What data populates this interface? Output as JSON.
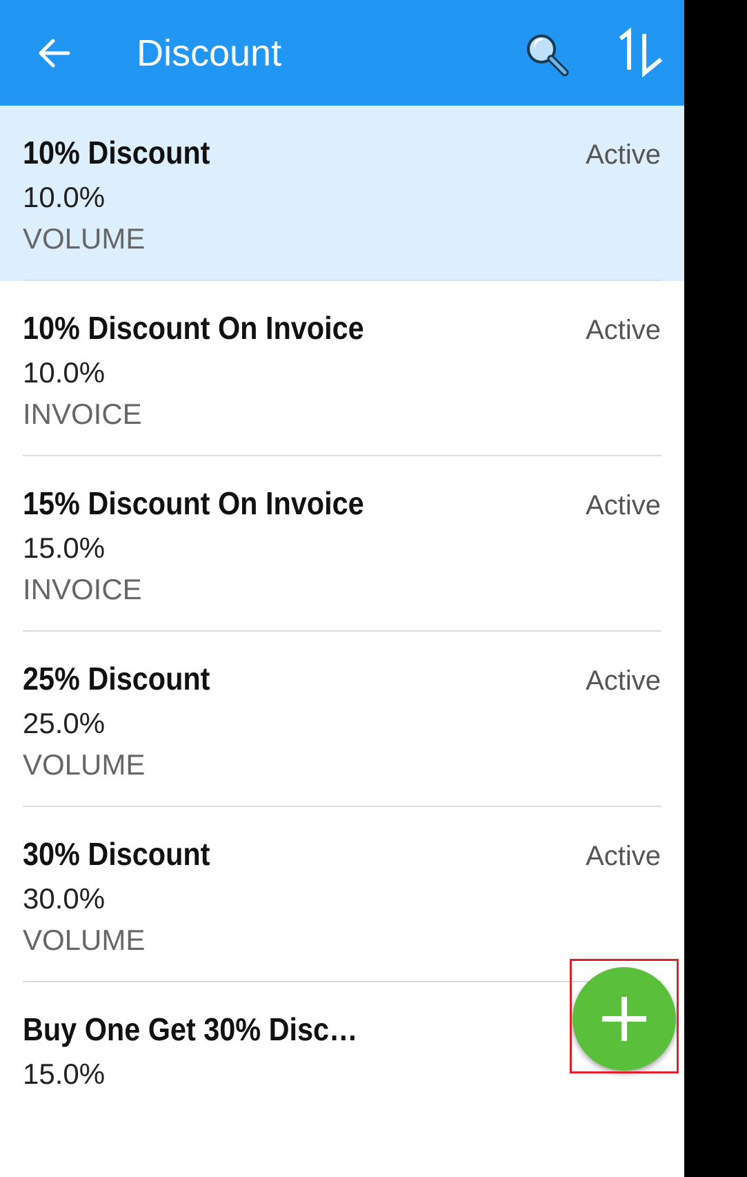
{
  "app_bar": {
    "title": "Discount",
    "color": "#2196f3",
    "back_icon": "arrow-left-icon",
    "search_icon": "search-icon",
    "sort_icon": "sort-icon"
  },
  "discounts": [
    {
      "name": "10% Discount",
      "amount": "10.0%",
      "type": "VOLUME",
      "status": "Active",
      "selected": true
    },
    {
      "name": "10% Discount On Invoice",
      "amount": "10.0%",
      "type": "INVOICE",
      "status": "Active"
    },
    {
      "name": "15% Discount On Invoice",
      "amount": "15.0%",
      "type": "INVOICE",
      "status": "Active"
    },
    {
      "name": "25% Discount",
      "amount": "25.0%",
      "type": "VOLUME",
      "status": "Active"
    },
    {
      "name": "30% Discount",
      "amount": "30.0%",
      "type": "VOLUME",
      "status": "Active"
    },
    {
      "name": "Buy One Get 30% Discoun…",
      "amount": "15.0%",
      "type": "",
      "status": ""
    }
  ],
  "fab": {
    "icon": "plus-icon",
    "color": "#5abf3b"
  },
  "colors": {
    "selected_row": "#ddeefc",
    "highlight_box": "#e0202a"
  }
}
